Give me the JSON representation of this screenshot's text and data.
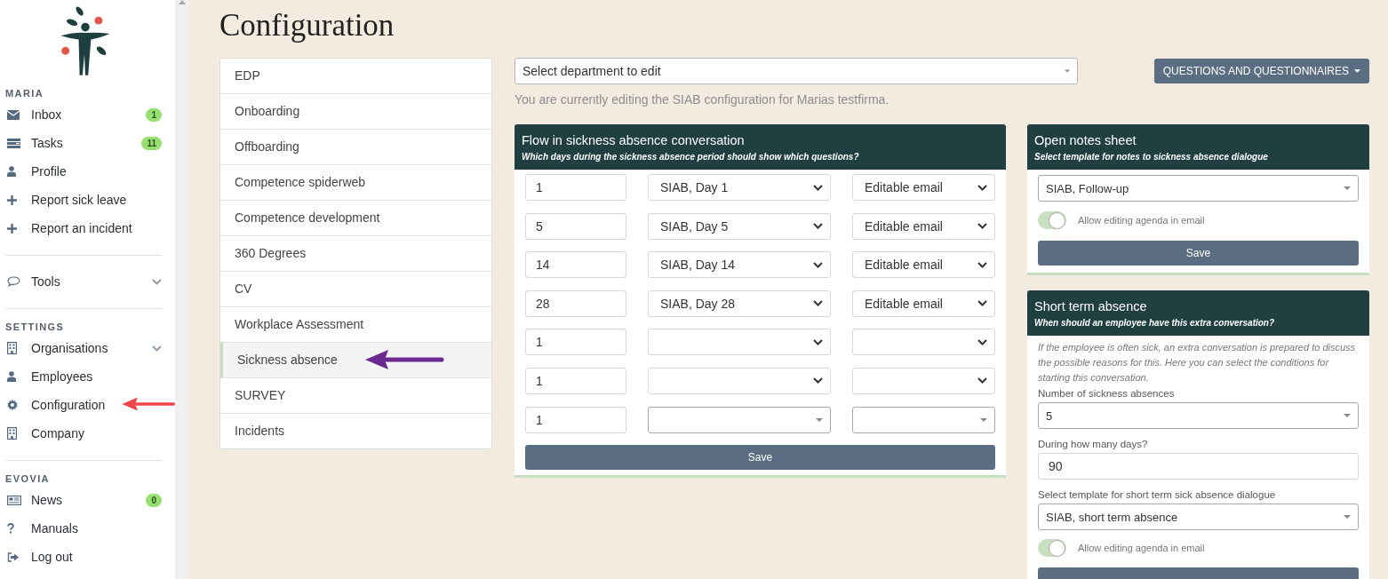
{
  "sidebar": {
    "sections": [
      {
        "heading": "MARIA",
        "items": [
          {
            "label": "Inbox",
            "badge": "1"
          },
          {
            "label": "Tasks",
            "badge": "11"
          },
          {
            "label": "Profile"
          },
          {
            "label": "Report sick leave"
          },
          {
            "label": "Report an incident"
          }
        ]
      },
      {
        "items": [
          {
            "label": "Tools",
            "expandable": true
          }
        ]
      },
      {
        "heading": "SETTINGS",
        "items": [
          {
            "label": "Organisations",
            "expandable": true
          },
          {
            "label": "Employees"
          },
          {
            "label": "Configuration",
            "pointer_arrow": {
              "color": "#f2454a"
            }
          },
          {
            "label": "Company"
          }
        ]
      },
      {
        "heading": "EVOVIA",
        "items": [
          {
            "label": "News",
            "badge": "0"
          },
          {
            "label": "Manuals"
          },
          {
            "label": "Log out"
          }
        ]
      }
    ]
  },
  "page": {
    "title": "Configuration"
  },
  "menu": [
    {
      "label": "EDP",
      "selected": false
    },
    {
      "label": "Onboarding",
      "selected": false
    },
    {
      "label": "Offboarding",
      "selected": false
    },
    {
      "label": "Competence spiderweb",
      "selected": false
    },
    {
      "label": "Competence development",
      "selected": false
    },
    {
      "label": "360 Degrees",
      "selected": false
    },
    {
      "label": "CV",
      "selected": false
    },
    {
      "label": "Workplace Assessment",
      "selected": false
    },
    {
      "label": "Sickness absence",
      "selected": true,
      "pointer_arrow": {
        "color": "#6b2a90"
      }
    },
    {
      "label": "SURVEY",
      "selected": false
    },
    {
      "label": "Incidents",
      "selected": false
    }
  ],
  "department_select": {
    "placeholder": "Select department to edit"
  },
  "questions_button": {
    "label": "QUESTIONS AND QUESTIONNAIRES"
  },
  "info_text": "You are currently editing the SIAB configuration for Marias testfirma.",
  "flow_card": {
    "title": "Flow in sickness absence conversation",
    "subtitle": "Which days during the sickness absence period should show which questions?",
    "rows": [
      {
        "kind": "native",
        "day": "1",
        "template": "SIAB, Day 1",
        "delivery": "Editable email"
      },
      {
        "kind": "native",
        "day": "5",
        "template": "SIAB, Day 5",
        "delivery": "Editable email"
      },
      {
        "kind": "native",
        "day": "14",
        "template": "SIAB, Day 14",
        "delivery": "Editable email"
      },
      {
        "kind": "native",
        "day": "28",
        "template": "SIAB, Day 28",
        "delivery": "Editable email"
      },
      {
        "kind": "native",
        "day": "1"
      },
      {
        "kind": "native",
        "day": "1"
      },
      {
        "kind": "custom",
        "day": "1"
      }
    ],
    "save": "Save"
  },
  "notes_card": {
    "title": "Open notes sheet",
    "subtitle": "Select template for notes to sickness absence dialogue",
    "template": "SIAB, Follow-up",
    "toggle": {
      "label": "Allow editing agenda in email",
      "on": true
    },
    "save": "Save"
  },
  "short_term_card": {
    "title": "Short term absence",
    "subtitle": "When should an employee have this extra conversation?",
    "description": "If the employee is often sick, an extra conversation is prepared to discuss the possible reasons for this. Here you can select the conditions for starting this conversation.",
    "fields": [
      {
        "kind": "select",
        "label": "Number of sickness absences",
        "value": "5"
      },
      {
        "kind": "input",
        "label": "During how many days?",
        "value": "90"
      },
      {
        "kind": "select",
        "label": "Select template for short term sick absence dialogue",
        "value": "SIAB, short term absence"
      }
    ],
    "toggle": {
      "label": "Allow editing agenda in email",
      "on": true
    }
  }
}
